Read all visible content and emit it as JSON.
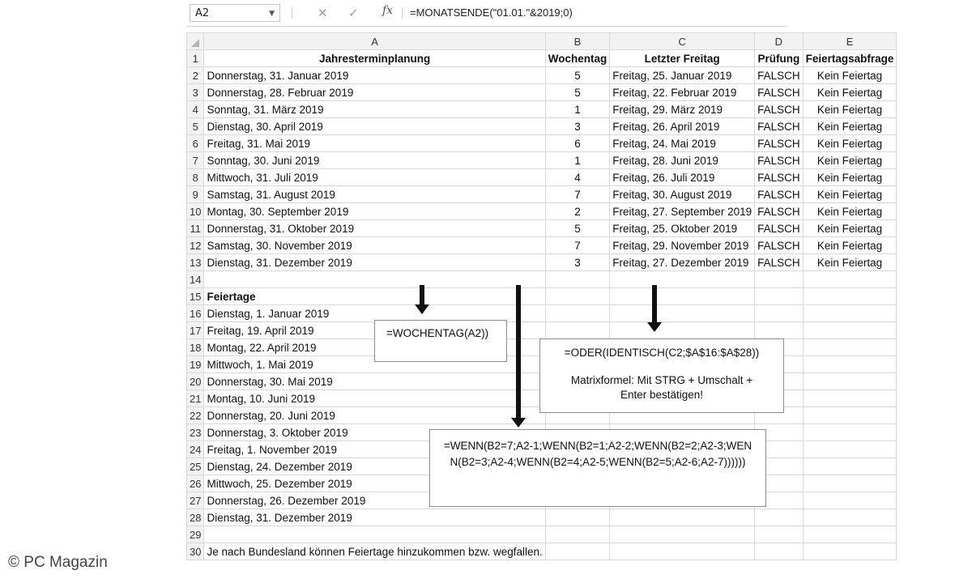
{
  "formula_bar": {
    "name_box": "A2",
    "formula": "=MONATSENDE(\"01.01.\"&2019;0)",
    "fx_label": "fx",
    "cancel_icon": "close-icon",
    "enter_icon": "check-icon"
  },
  "columns": [
    "A",
    "B",
    "C",
    "D",
    "E"
  ],
  "row_numbers": [
    "1",
    "2",
    "3",
    "4",
    "5",
    "6",
    "7",
    "8",
    "9",
    "10",
    "11",
    "12",
    "13",
    "14",
    "15",
    "16",
    "17",
    "18",
    "19",
    "20",
    "21",
    "22",
    "23",
    "24",
    "25",
    "26",
    "27",
    "28",
    "29",
    "30"
  ],
  "header": {
    "a": "Jahresterminplanung",
    "b": "Wochentag",
    "c": "Letzter Freitag",
    "d": "Prüfung",
    "e": "Feiertagsabfrage"
  },
  "rows": [
    [
      "Donnerstag, 31. Januar 2019",
      "5",
      "Freitag, 25. Januar 2019",
      "FALSCH",
      "Kein Feiertag"
    ],
    [
      "Donnerstag, 28. Februar 2019",
      "5",
      "Freitag, 22. Februar 2019",
      "FALSCH",
      "Kein Feiertag"
    ],
    [
      "Sonntag, 31. März 2019",
      "1",
      "Freitag, 29. März 2019",
      "FALSCH",
      "Kein Feiertag"
    ],
    [
      "Dienstag, 30. April 2019",
      "3",
      "Freitag, 26. April 2019",
      "FALSCH",
      "Kein Feiertag"
    ],
    [
      "Freitag, 31. Mai 2019",
      "6",
      "Freitag, 24. Mai 2019",
      "FALSCH",
      "Kein Feiertag"
    ],
    [
      "Sonntag, 30. Juni 2019",
      "1",
      "Freitag, 28. Juni 2019",
      "FALSCH",
      "Kein Feiertag"
    ],
    [
      "Mittwoch, 31. Juli 2019",
      "4",
      "Freitag, 26. Juli 2019",
      "FALSCH",
      "Kein Feiertag"
    ],
    [
      "Samstag, 31. August 2019",
      "7",
      "Freitag, 30. August 2019",
      "FALSCH",
      "Kein Feiertag"
    ],
    [
      "Montag, 30. September 2019",
      "2",
      "Freitag, 27. September 2019",
      "FALSCH",
      "Kein Feiertag"
    ],
    [
      "Donnerstag, 31. Oktober 2019",
      "5",
      "Freitag, 25. Oktober 2019",
      "FALSCH",
      "Kein Feiertag"
    ],
    [
      "Samstag, 30. November 2019",
      "7",
      "Freitag, 29. November 2019",
      "FALSCH",
      "Kein Feiertag"
    ],
    [
      "Dienstag, 31. Dezember 2019",
      "3",
      "Freitag, 27. Dezember 2019",
      "FALSCH",
      "Kein Feiertag"
    ]
  ],
  "holidays_title": "Feiertage",
  "holidays": [
    "Dienstag, 1. Januar 2019",
    "Freitag, 19. April 2019",
    "Montag, 22. April 2019",
    "Mittwoch, 1. Mai 2019",
    "Donnerstag, 30. Mai 2019",
    "Montag, 10. Juni 2019",
    "Donnerstag, 20. Juni 2019",
    "Donnerstag, 3. Oktober 2019",
    "Freitag, 1. November 2019",
    "Dienstag, 24. Dezember 2019",
    "Mittwoch, 25. Dezember 2019",
    "Donnerstag, 26. Dezember 2019",
    "Dienstag, 31. Dezember 2019"
  ],
  "footnote": "Je nach Bundesland können Feiertage hinzukommen bzw. wegfallen.",
  "notes": {
    "wochentag": "=WOCHENTAG(A2))",
    "oder_formula": "=ODER(IDENTISCH(C2;$A$16:$A$28))",
    "oder_hint": "Matrixformel: Mit STRG + Umschalt + Enter bestätigen!",
    "wenn_formula": "=WENN(B2=7;A2-1;WENN(B2=1;A2-2;WENN(B2=2;A2-3;WENN(B2=3;A2-4;WENN(B2=4;A2-5;WENN(B2=5;A2-6;A2-7))))))"
  },
  "watermark": "© PC Magazin"
}
